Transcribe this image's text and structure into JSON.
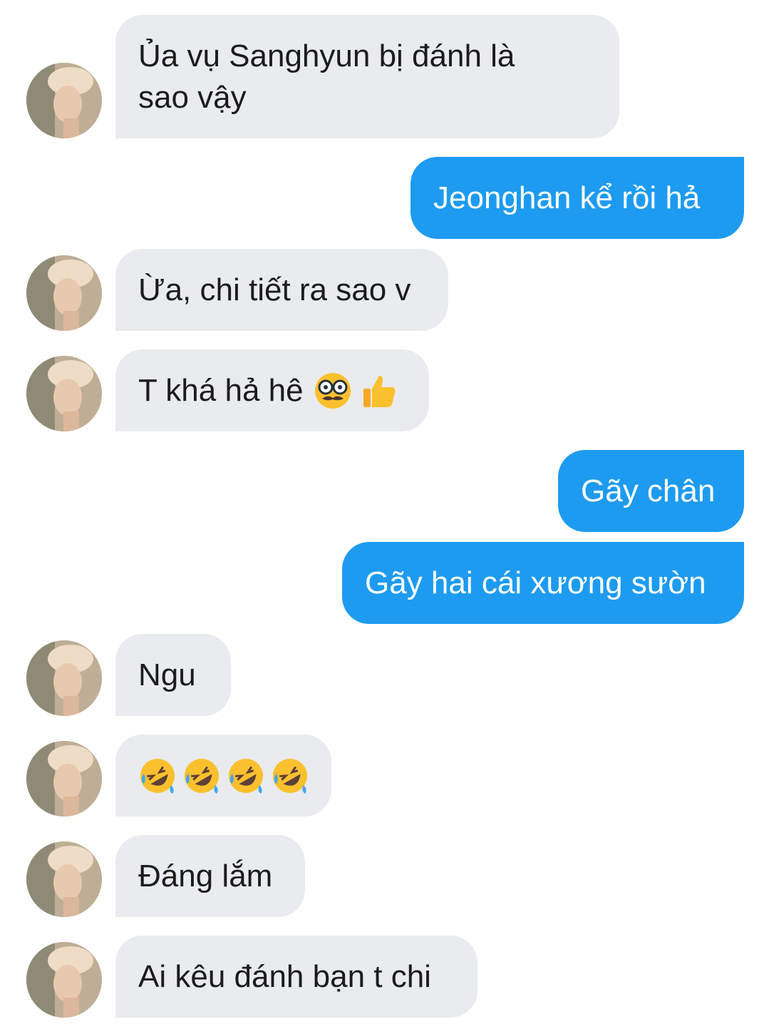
{
  "messages": [
    {
      "side": "in",
      "text": "Ủa vụ Sanghyun bị đánh là\nsao vậy"
    },
    {
      "side": "out",
      "text": "Jeonghan kể rồi hả"
    },
    {
      "side": "in",
      "text": "Ừa, chi tiết ra sao v"
    },
    {
      "side": "in",
      "text": "T khá hả hê",
      "emojis": [
        "disguised-face",
        "thumbs-up"
      ]
    },
    {
      "side": "out",
      "text": "Gãy chân"
    },
    {
      "side": "out",
      "text": "Gãy hai cái xương sườn"
    },
    {
      "side": "in",
      "text": "Ngu"
    },
    {
      "side": "in",
      "text": "",
      "emojis": [
        "rolling-on-floor-laughing",
        "rolling-on-floor-laughing",
        "rolling-on-floor-laughing",
        "rolling-on-floor-laughing"
      ]
    },
    {
      "side": "in",
      "text": "Đáng lắm"
    },
    {
      "side": "in",
      "text": "Ai kêu đánh bạn t chi"
    }
  ],
  "colors": {
    "outgoing_bubble": "#1d9bf0",
    "incoming_bubble": "#e9ebee"
  }
}
